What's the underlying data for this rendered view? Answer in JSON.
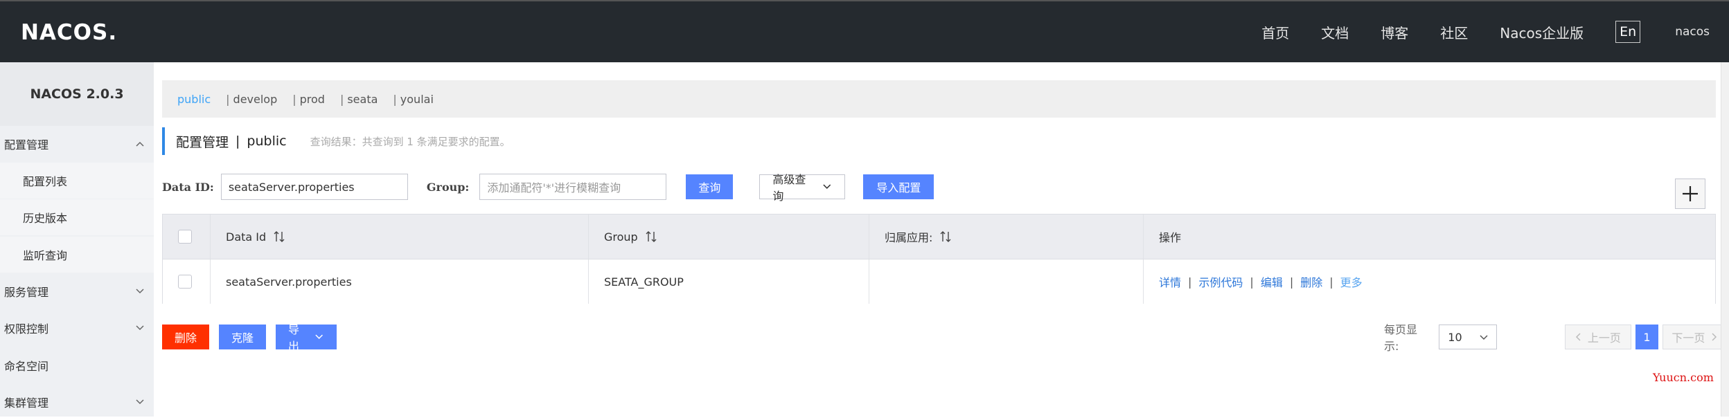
{
  "header": {
    "logo": "NACOS.",
    "nav": [
      "首页",
      "文档",
      "博客",
      "社区",
      "Nacos企业版"
    ],
    "lang": "En",
    "user": "nacos"
  },
  "sidebar": {
    "version": "NACOS 2.0.3",
    "items": [
      {
        "label": "配置管理",
        "level": "top",
        "state": "expanded"
      },
      {
        "label": "配置列表",
        "level": "sub"
      },
      {
        "label": "历史版本",
        "level": "sub"
      },
      {
        "label": "监听查询",
        "level": "sub"
      },
      {
        "label": "服务管理",
        "level": "top",
        "state": "collapsed"
      },
      {
        "label": "权限控制",
        "level": "top",
        "state": "collapsed"
      },
      {
        "label": "命名空间",
        "level": "top"
      },
      {
        "label": "集群管理",
        "level": "top",
        "state": "collapsed"
      }
    ]
  },
  "namespaces": {
    "active": "public",
    "others": [
      "develop",
      "prod",
      "seata",
      "youlai"
    ],
    "separator": "|"
  },
  "title": {
    "text": "配置管理",
    "separator": "|",
    "namespace": "public",
    "result": "查询结果：共查询到 1 条满足要求的配置。"
  },
  "search": {
    "dataid_label": "Data ID:",
    "dataid_value": "seataServer.properties",
    "group_label": "Group:",
    "group_placeholder": "添加通配符'*'进行模糊查询",
    "query_button": "查询",
    "advanced_button": "高级查询",
    "import_button": "导入配置",
    "add_icon": "plus-icon"
  },
  "table": {
    "headers": [
      "Data Id",
      "Group",
      "归属应用:",
      "操作"
    ],
    "rows": [
      {
        "data_id": "seataServer.properties",
        "group": "SEATA_GROUP",
        "app": ""
      }
    ],
    "ops": [
      "详情",
      "示例代码",
      "编辑",
      "删除",
      "更多"
    ],
    "op_sep": "|"
  },
  "actions": {
    "delete": "删除",
    "clone": "克隆",
    "export": "导出"
  },
  "pager": {
    "label": "每页显示:",
    "page_size": "10",
    "prev": "上一页",
    "current": "1",
    "next": "下一页"
  },
  "watermark": "Yuucn.com",
  "colors": {
    "header_bg": "#252a2f",
    "primary": "#5584ff",
    "danger": "#ff3000",
    "link": "#2d77d9",
    "accent_tab": "#3ea4f7"
  }
}
